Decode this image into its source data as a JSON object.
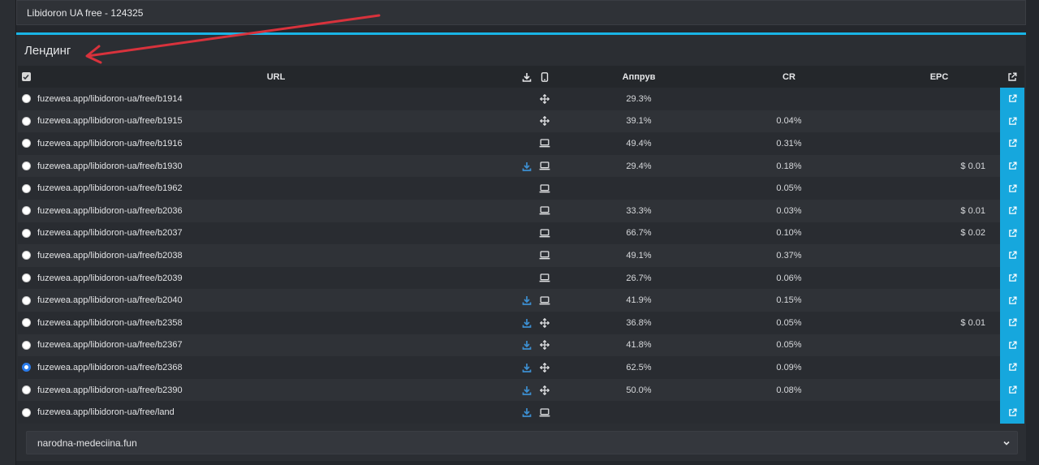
{
  "header": {
    "title": "Libidoron UA free - 124325"
  },
  "panel": {
    "title": "Лендинг"
  },
  "table": {
    "columns": {
      "url": "URL",
      "approve": "Аппрув",
      "cr": "CR",
      "epc": "EPC"
    },
    "rows": [
      {
        "url": "fuzewea.app/libidoron-ua/free/b1914",
        "download": false,
        "device": "move",
        "approve": "29.3%",
        "cr": "",
        "epc": "",
        "selected": false
      },
      {
        "url": "fuzewea.app/libidoron-ua/free/b1915",
        "download": false,
        "device": "move",
        "approve": "39.1%",
        "cr": "0.04%",
        "epc": "",
        "selected": false
      },
      {
        "url": "fuzewea.app/libidoron-ua/free/b1916",
        "download": false,
        "device": "laptop",
        "approve": "49.4%",
        "cr": "0.31%",
        "epc": "",
        "selected": false
      },
      {
        "url": "fuzewea.app/libidoron-ua/free/b1930",
        "download": true,
        "device": "laptop",
        "approve": "29.4%",
        "cr": "0.18%",
        "epc": "$ 0.01",
        "selected": false
      },
      {
        "url": "fuzewea.app/libidoron-ua/free/b1962",
        "download": false,
        "device": "laptop",
        "approve": "",
        "cr": "0.05%",
        "epc": "",
        "selected": false
      },
      {
        "url": "fuzewea.app/libidoron-ua/free/b2036",
        "download": false,
        "device": "laptop",
        "approve": "33.3%",
        "cr": "0.03%",
        "epc": "$ 0.01",
        "selected": false
      },
      {
        "url": "fuzewea.app/libidoron-ua/free/b2037",
        "download": false,
        "device": "laptop",
        "approve": "66.7%",
        "cr": "0.10%",
        "epc": "$ 0.02",
        "selected": false
      },
      {
        "url": "fuzewea.app/libidoron-ua/free/b2038",
        "download": false,
        "device": "laptop",
        "approve": "49.1%",
        "cr": "0.37%",
        "epc": "",
        "selected": false
      },
      {
        "url": "fuzewea.app/libidoron-ua/free/b2039",
        "download": false,
        "device": "laptop",
        "approve": "26.7%",
        "cr": "0.06%",
        "epc": "",
        "selected": false
      },
      {
        "url": "fuzewea.app/libidoron-ua/free/b2040",
        "download": true,
        "device": "laptop",
        "approve": "41.9%",
        "cr": "0.15%",
        "epc": "",
        "selected": false
      },
      {
        "url": "fuzewea.app/libidoron-ua/free/b2358",
        "download": true,
        "device": "move",
        "approve": "36.8%",
        "cr": "0.05%",
        "epc": "$ 0.01",
        "selected": false
      },
      {
        "url": "fuzewea.app/libidoron-ua/free/b2367",
        "download": true,
        "device": "move",
        "approve": "41.8%",
        "cr": "0.05%",
        "epc": "",
        "selected": false
      },
      {
        "url": "fuzewea.app/libidoron-ua/free/b2368",
        "download": true,
        "device": "move",
        "approve": "62.5%",
        "cr": "0.09%",
        "epc": "",
        "selected": true
      },
      {
        "url": "fuzewea.app/libidoron-ua/free/b2390",
        "download": true,
        "device": "move",
        "approve": "50.0%",
        "cr": "0.08%",
        "epc": "",
        "selected": false
      },
      {
        "url": "fuzewea.app/libidoron-ua/free/land",
        "download": true,
        "device": "laptop",
        "approve": "",
        "cr": "",
        "epc": "",
        "selected": false
      }
    ]
  },
  "domain_select": {
    "value": "narodna-medeciina.fun"
  },
  "colors": {
    "accent": "#19b4e6",
    "open_button": "#16a7dd",
    "download_icon": "#3d8fd1",
    "annotation_arrow": "#d8323c"
  },
  "icons": {
    "download": "download-icon",
    "move": "move-icon",
    "laptop": "laptop-icon",
    "mobile": "mobile-icon",
    "external": "external-link-icon"
  }
}
